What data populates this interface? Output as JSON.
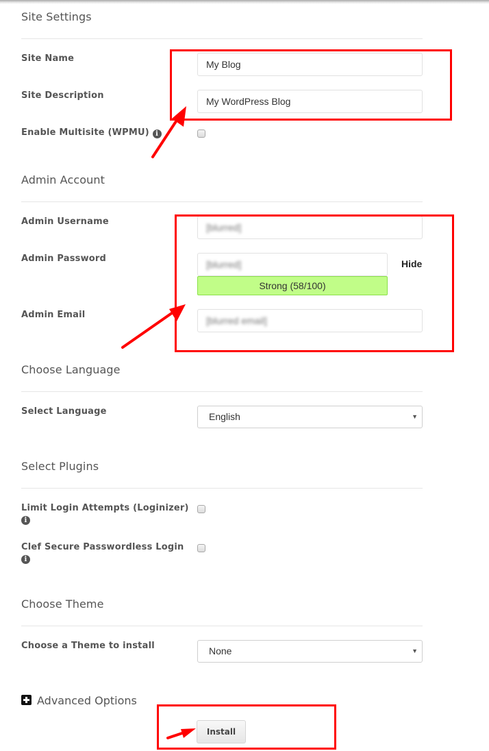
{
  "site_settings": {
    "title": "Site Settings",
    "site_name_label": "Site Name",
    "site_name_value": "My Blog",
    "site_description_label": "Site Description",
    "site_description_value": "My WordPress Blog",
    "multisite_label": "Enable Multisite (WPMU)",
    "multisite_checked": false,
    "info_icon": "i"
  },
  "admin_account": {
    "title": "Admin Account",
    "username_label": "Admin Username",
    "username_value": "[blurred]",
    "password_label": "Admin Password",
    "password_value": "[blurred]",
    "hide_label": "Hide",
    "strength_text": "Strong (58/100)",
    "strength_color": "#c1fd88",
    "email_label": "Admin Email",
    "email_value": "[blurred email]"
  },
  "language": {
    "title": "Choose Language",
    "select_label": "Select Language",
    "selected": "English",
    "caret": "▼"
  },
  "plugins": {
    "title": "Select Plugins",
    "items": [
      {
        "label": "Limit Login Attempts (Loginizer)",
        "checked": false
      },
      {
        "label": "Clef Secure Passwordless Login",
        "checked": false
      }
    ]
  },
  "theme": {
    "title": "Choose Theme",
    "select_label": "Choose a Theme to install",
    "selected": "None",
    "caret": "▼"
  },
  "advanced": {
    "label": "Advanced Options"
  },
  "install_button": "Install",
  "annotation_color": "#ff0000"
}
